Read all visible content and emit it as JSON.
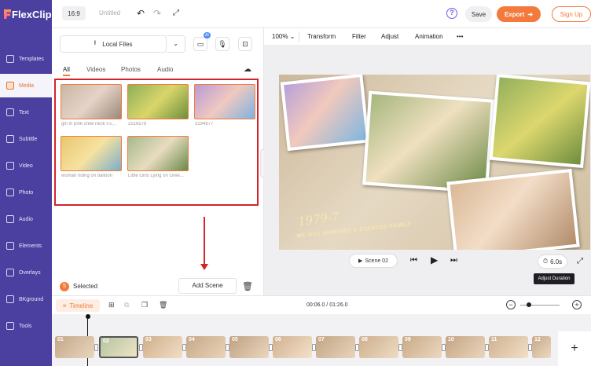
{
  "app": {
    "logo": "FlexClip",
    "aspect_ratio": "16:9",
    "title": "Untitled"
  },
  "header": {
    "save_label": "Save",
    "export_label": "Export",
    "signup_label": "Sign Up"
  },
  "sidebar": {
    "items": [
      {
        "label": "Templates",
        "icon": "templates-icon",
        "active": false
      },
      {
        "label": "Media",
        "icon": "media-icon",
        "active": true
      },
      {
        "label": "Text",
        "icon": "text-icon",
        "active": false
      },
      {
        "label": "Subtitle",
        "icon": "subtitle-icon",
        "active": false
      },
      {
        "label": "Video",
        "icon": "video-icon",
        "active": false
      },
      {
        "label": "Photo",
        "icon": "photo-icon",
        "active": false
      },
      {
        "label": "Audio",
        "icon": "audio-icon",
        "active": false
      },
      {
        "label": "Elements",
        "icon": "elements-icon",
        "active": false
      },
      {
        "label": "Overlays",
        "icon": "overlays-icon",
        "active": false
      },
      {
        "label": "BKground",
        "icon": "background-icon",
        "active": false
      },
      {
        "label": "Tools",
        "icon": "tools-icon",
        "active": false
      }
    ]
  },
  "panel": {
    "upload_label": "Local Files",
    "ai_badge": "AI",
    "tabs": [
      "All",
      "Videos",
      "Photos",
      "Audio"
    ],
    "active_tab": "All",
    "media": [
      {
        "name": "girl in pink crew neck t-s..."
      },
      {
        "name": "2516578"
      },
      {
        "name": "3194977"
      },
      {
        "name": "woman riding on balloon"
      },
      {
        "name": "Little Girls Lying on Gree..."
      }
    ],
    "selected_count": "5",
    "selected_label": "Selected",
    "add_scene_label": "Add Scene"
  },
  "editor_toolbar": {
    "zoom": "100%",
    "items": [
      "Transform",
      "Filter",
      "Adjust",
      "Animation"
    ],
    "more": "•••"
  },
  "canvas": {
    "text_year": "1979-7",
    "text_caption": "WE GOT MARRIED & STARTED FAMILY"
  },
  "player": {
    "scene_label": "Scene 02",
    "duration": "6.0s",
    "tooltip": "Adjust Duration"
  },
  "timeline": {
    "label": "Timeline",
    "time_current": "00:06.0",
    "time_total": "01:26.0",
    "time_display": "00:06.0 / 01:26.0",
    "clip_numbers": [
      "01",
      "02",
      "03",
      "04",
      "05",
      "06",
      "07",
      "08",
      "09",
      "10",
      "11",
      "12"
    ]
  },
  "colors": {
    "accent": "#f37a3c",
    "sidebar": "#4b3fa0",
    "highlight": "#d3242a"
  }
}
